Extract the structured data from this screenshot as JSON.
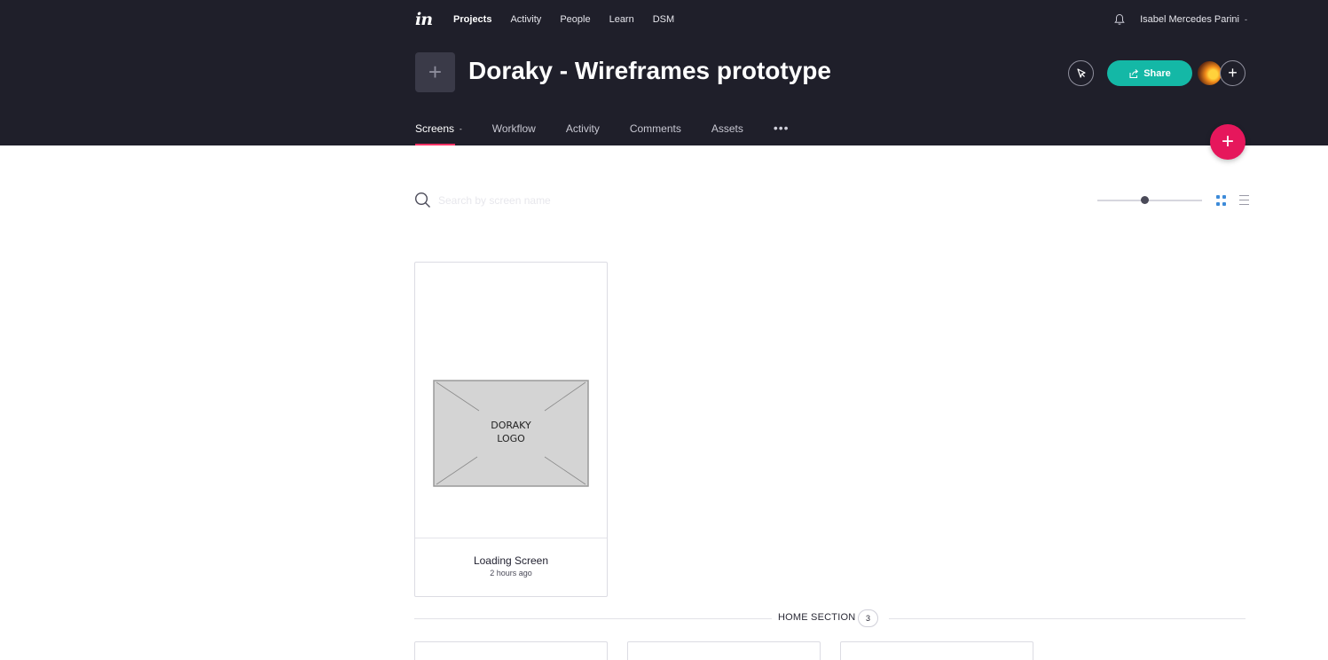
{
  "topnav": {
    "logo": "in",
    "links": [
      "Projects",
      "Activity",
      "People",
      "Learn",
      "DSM"
    ],
    "user_name": "Isabel Mercedes Parini"
  },
  "project": {
    "title": "Doraky - Wireframes prototype",
    "share_label": "Share"
  },
  "tabs": [
    "Screens",
    "Workflow",
    "Activity",
    "Comments",
    "Assets"
  ],
  "search": {
    "placeholder": "Search by screen name"
  },
  "view": {
    "zoom": 0.45,
    "mode": "grid"
  },
  "screens": [
    {
      "placeholder_text": "DORAKY LOGO",
      "name": "Loading Screen",
      "time": "2 hours ago"
    }
  ],
  "section": {
    "name": "HOME SECTION",
    "count": "3"
  },
  "colors": {
    "header_bg": "#1f1f2a",
    "accent_pink": "#e6175c",
    "share_teal": "#14b8a6",
    "grid_active": "#3d8bd9"
  }
}
